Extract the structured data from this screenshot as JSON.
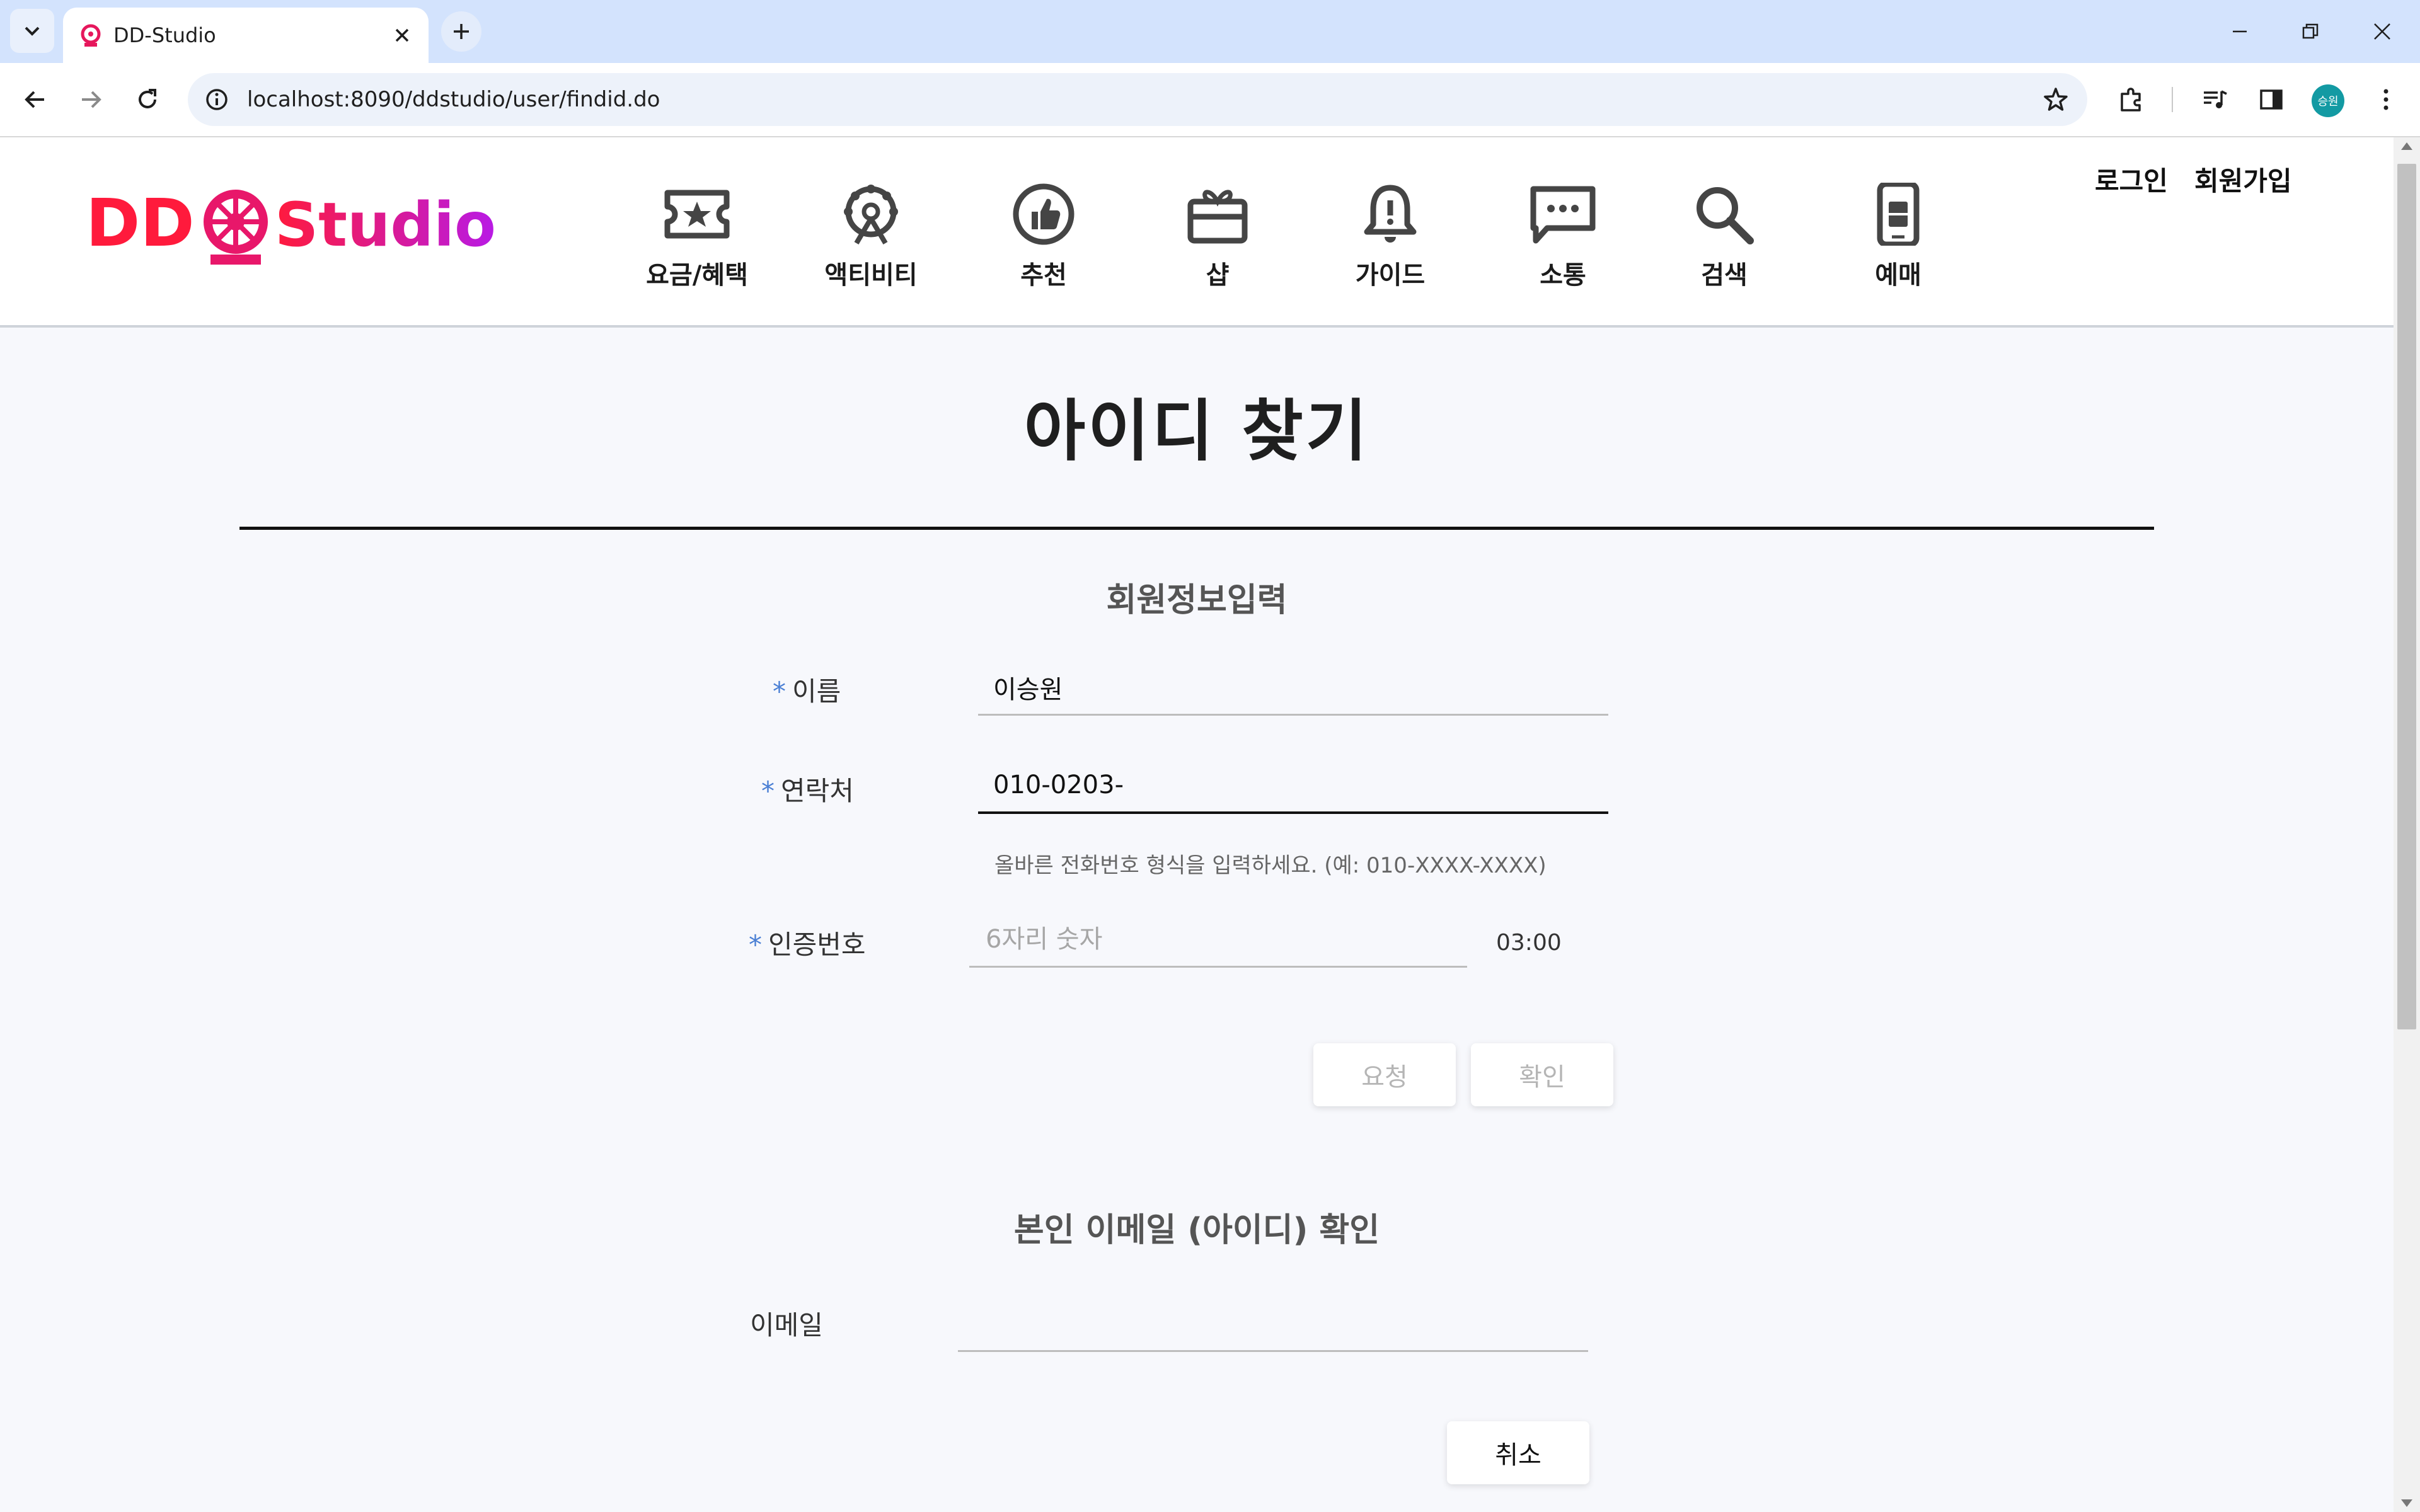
{
  "browser": {
    "tab_title": "DD-Studio",
    "url": "localhost:8090/ddstudio/user/findid.do",
    "profile_initials": "승원"
  },
  "header": {
    "logo_text": "DD Studio",
    "nav": [
      {
        "label": "요금/혜택",
        "icon": "ticket-icon"
      },
      {
        "label": "액티비티",
        "icon": "ferris-wheel-icon"
      },
      {
        "label": "추천",
        "icon": "thumbs-up-icon"
      },
      {
        "label": "샵",
        "icon": "gift-icon"
      },
      {
        "label": "가이드",
        "icon": "bell-icon"
      },
      {
        "label": "소통",
        "icon": "chat-icon"
      },
      {
        "label": "검색",
        "icon": "search-icon"
      },
      {
        "label": "예매",
        "icon": "phone-ticket-icon"
      }
    ],
    "login": "로그인",
    "signup": "회원가입"
  },
  "page": {
    "title": "아이디 찾기",
    "section1_title": "회원정보입력",
    "required_mark": "*",
    "name_label": "이름",
    "name_value": "이승원",
    "phone_label": "연락처",
    "phone_value": "010-0203-",
    "phone_hint": "올바른 전화번호 형식을 입력하세요. (예: 010-XXXX-XXXX)",
    "code_label": "인증번호",
    "code_placeholder": "6자리 숫자",
    "timer": "03:00",
    "request_button": "요청",
    "confirm_button": "확인",
    "section2_title": "본인 이메일 (아이디) 확인",
    "email_label": "이메일",
    "email_value": "",
    "cancel_button": "취소"
  },
  "colors": {
    "logo_gradient_start": "#ff1a3c",
    "logo_gradient_end": "#b81ae6",
    "required": "#4a7fd4",
    "page_bg": "#f7f8fc"
  }
}
